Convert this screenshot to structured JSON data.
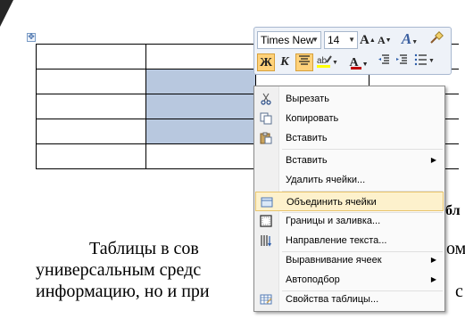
{
  "table_handle_glyph": "✥",
  "document": {
    "text_visible": [
      "Таблицы в сов",
      "ом",
      "универсальным средс",
      "информацию, но и при",
      "бл",
      "с"
    ]
  },
  "mini_toolbar": {
    "font_name": "Times New",
    "font_size": "14",
    "grow_font": "A",
    "shrink_font": "A",
    "bold": "Ж",
    "italic": "К",
    "font_color_letter": "A"
  },
  "context_menu": {
    "items": [
      {
        "label": "Вырезать",
        "icon": "scissors-icon"
      },
      {
        "label": "Копировать",
        "icon": "copy-icon"
      },
      {
        "label": "Вставить",
        "icon": "paste-icon"
      },
      {
        "label": "Вставить",
        "icon": "",
        "submenu": true
      },
      {
        "label": "Удалить ячейки...",
        "icon": ""
      },
      {
        "label": "Объединить ячейки",
        "icon": "merge-cells-icon",
        "highlighted": true
      },
      {
        "label": "Границы и заливка...",
        "icon": "borders-icon"
      },
      {
        "label": "Направление текста...",
        "icon": "text-direction-icon"
      },
      {
        "label": "Выравнивание ячеек",
        "icon": "",
        "submenu": true
      },
      {
        "label": "Автоподбор",
        "icon": "",
        "submenu": true
      },
      {
        "label": "Свойства таблицы...",
        "icon": "table-properties-icon"
      }
    ],
    "submenu_glyph": "▶"
  },
  "colors": {
    "selection": "#b8c8df",
    "menu_highlight": "#fdf1cc",
    "font_color_bar": "#c00000",
    "highlight_bar": "#ffff00"
  }
}
